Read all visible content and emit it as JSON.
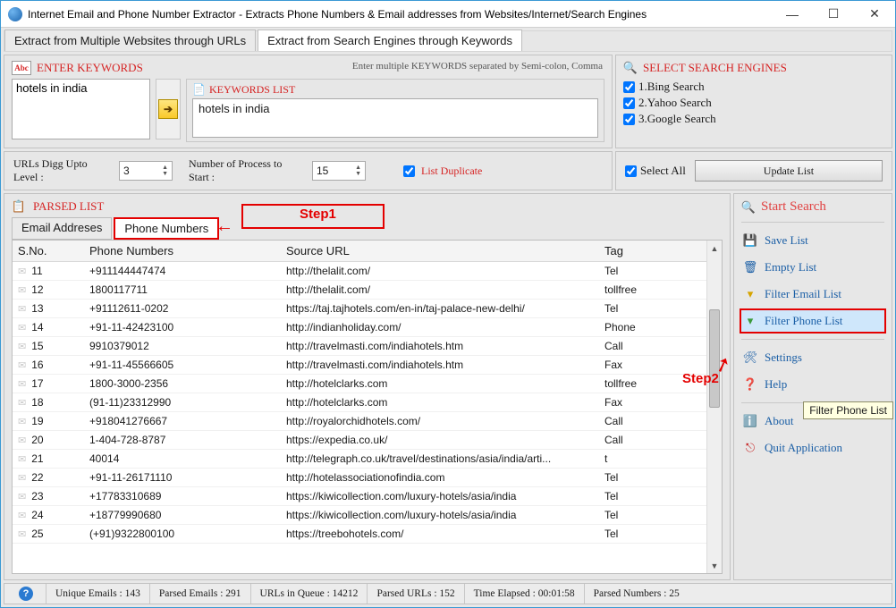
{
  "window": {
    "title": "Internet Email and Phone Number Extractor - Extracts Phone Numbers & Email addresses from Websites/Internet/Search Engines"
  },
  "topTabs": {
    "multiple": "Extract from Multiple Websites through URLs",
    "keywords": "Extract from Search Engines through Keywords"
  },
  "kw": {
    "title": "ENTER KEYWORDS",
    "hint": "Enter multiple KEYWORDS separated by Semi-colon, Comma",
    "input": "hotels in india",
    "listTitle": "KEYWORDS LIST",
    "listItem": "hotels in india"
  },
  "se": {
    "title": "SELECT SEARCH ENGINES",
    "items": [
      "1.Bing Search",
      "2.Yahoo Search",
      "3.Google Search"
    ]
  },
  "opts": {
    "diggLabel": "URLs Digg Upto Level :",
    "diggVal": "3",
    "procLabel": "Number of Process to Start :",
    "procVal": "15",
    "listDup": "List Duplicate",
    "selectAll": "Select All",
    "update": "Update List"
  },
  "parsed": {
    "title": "PARSED LIST",
    "tabEmail": "Email Addreses",
    "tabPhone": "Phone Numbers",
    "cols": {
      "sno": "S.No.",
      "phone": "Phone Numbers",
      "src": "Source URL",
      "tag": "Tag"
    },
    "rows": [
      {
        "sno": "11",
        "phone": "+911144447474",
        "src": "http://thelalit.com/",
        "tag": "Tel"
      },
      {
        "sno": "12",
        "phone": "1800117711",
        "src": "http://thelalit.com/",
        "tag": "tollfree"
      },
      {
        "sno": "13",
        "phone": "+91112611-0202",
        "src": "https://taj.tajhotels.com/en-in/taj-palace-new-delhi/",
        "tag": "Tel"
      },
      {
        "sno": "14",
        "phone": "+91-11-42423100",
        "src": "http://indianholiday.com/",
        "tag": "Phone"
      },
      {
        "sno": "15",
        "phone": "9910379012",
        "src": "http://travelmasti.com/indiahotels.htm",
        "tag": "Call"
      },
      {
        "sno": "16",
        "phone": "+91-11-45566605",
        "src": "http://travelmasti.com/indiahotels.htm",
        "tag": "Fax"
      },
      {
        "sno": "17",
        "phone": "1800-3000-2356",
        "src": "http://hotelclarks.com",
        "tag": "tollfree"
      },
      {
        "sno": "18",
        "phone": "(91-11)23312990",
        "src": "http://hotelclarks.com",
        "tag": "Fax"
      },
      {
        "sno": "19",
        "phone": "+918041276667",
        "src": "http://royalorchidhotels.com/",
        "tag": "Call"
      },
      {
        "sno": "20",
        "phone": "1-404-728-8787",
        "src": "https://expedia.co.uk/",
        "tag": "Call"
      },
      {
        "sno": "21",
        "phone": "40014",
        "src": "http://telegraph.co.uk/travel/destinations/asia/india/arti...",
        "tag": "t"
      },
      {
        "sno": "22",
        "phone": "+91-11-26171110",
        "src": "http://hotelassociationofindia.com",
        "tag": "Tel"
      },
      {
        "sno": "23",
        "phone": "+17783310689",
        "src": "https://kiwicollection.com/luxury-hotels/asia/india",
        "tag": "Tel"
      },
      {
        "sno": "24",
        "phone": "+18779990680",
        "src": "https://kiwicollection.com/luxury-hotels/asia/india",
        "tag": "Tel"
      },
      {
        "sno": "25",
        "phone": "(+91)9322800100",
        "src": "https://treebohotels.com/",
        "tag": "Tel"
      }
    ]
  },
  "annot": {
    "step1": "Step1",
    "step2": "Step2"
  },
  "sidebar": {
    "start": "Start Search",
    "save": "Save List",
    "empty": "Empty List",
    "filterEmail": "Filter Email List",
    "filterPhone": "Filter Phone List",
    "settings": "Settings",
    "help": "Help",
    "about": "About",
    "quit": "Quit Application",
    "tooltip": "Filter Phone List"
  },
  "status": {
    "uEmails": "Unique Emails :  143",
    "pEmails": "Parsed Emails :   291",
    "queue": "URLs in Queue :  14212",
    "pUrls": "Parsed URLs :   152",
    "elapsed": "Time Elapsed :   00:01:58",
    "pNums": "Parsed Numbers :   25"
  }
}
